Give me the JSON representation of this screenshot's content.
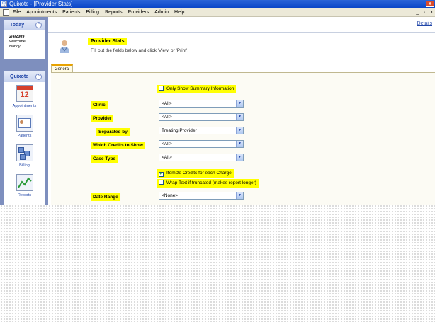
{
  "window": {
    "title": "Quixote - [Provider Stats]"
  },
  "menu": {
    "items": [
      "File",
      "Appointments",
      "Patients",
      "Billing",
      "Reports",
      "Providers",
      "Admin",
      "Help"
    ]
  },
  "window_controls": {
    "minimize": "_",
    "restore": "·",
    "close": "x"
  },
  "sidebar": {
    "today": {
      "title": "Today",
      "date": "2/4/2009",
      "welcome": "Welcome,",
      "user": "Nancy"
    },
    "quixote": {
      "title": "Quixote",
      "items": [
        {
          "label": "Appointments",
          "icon": "calendar-icon",
          "num": "12"
        },
        {
          "label": "Patients",
          "icon": "patient-card-icon"
        },
        {
          "label": "Billing",
          "icon": "billing-icon"
        },
        {
          "label": "Reports",
          "icon": "chart-icon"
        }
      ]
    }
  },
  "header": {
    "details_link": "Details",
    "title": "Provider Stats",
    "subtitle": "Fill out the fields below and click 'View' or 'Print'."
  },
  "tabs": [
    {
      "label": "General",
      "active": true
    }
  ],
  "form": {
    "summary_only": {
      "label": "Only Show Summary Information",
      "checked": false
    },
    "clinic": {
      "label": "Clinic",
      "value": "<All>"
    },
    "provider": {
      "label": "Provider",
      "value": "<All>"
    },
    "separated_by": {
      "label": "Separated by",
      "value": "Treating Provider"
    },
    "which_credits": {
      "label": "Which Credits to Show",
      "value": "<All>"
    },
    "case_type": {
      "label": "Case Type",
      "value": "<All>"
    },
    "itemize": {
      "label": "Itemize Credits for each Charge",
      "checked": true
    },
    "wrap_text": {
      "label": "Wrap Text if truncated (makes report longer)",
      "checked": false
    },
    "date_range": {
      "label": "Date Range",
      "value": "<None>"
    }
  },
  "colors": {
    "highlight": "#ffff00",
    "sidebar": "#7e8fbe",
    "title_bar": "#0a46c8",
    "link": "#2146a8"
  }
}
